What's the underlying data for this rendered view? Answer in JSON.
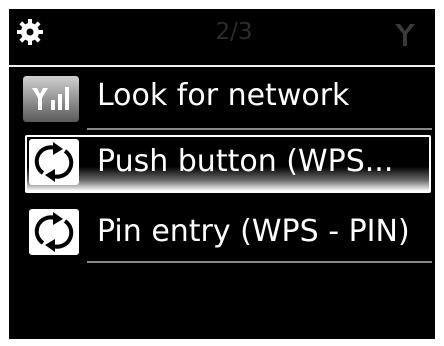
{
  "status_bar": {
    "settings_icon": "gear-icon",
    "page_indicator": "2/3",
    "signal_icon": "antenna-icon"
  },
  "menu": {
    "items": [
      {
        "icon": "signal-bars-icon",
        "label": "Look for network",
        "selected": false
      },
      {
        "icon": "wps-icon",
        "label": "Push button (WPS...",
        "selected": true
      },
      {
        "icon": "wps-icon",
        "label": "Pin entry (WPS - PIN)",
        "selected": false
      }
    ]
  },
  "colors": {
    "background": "#000000",
    "text": "#ffffff",
    "selection_border": "#ffffff"
  }
}
